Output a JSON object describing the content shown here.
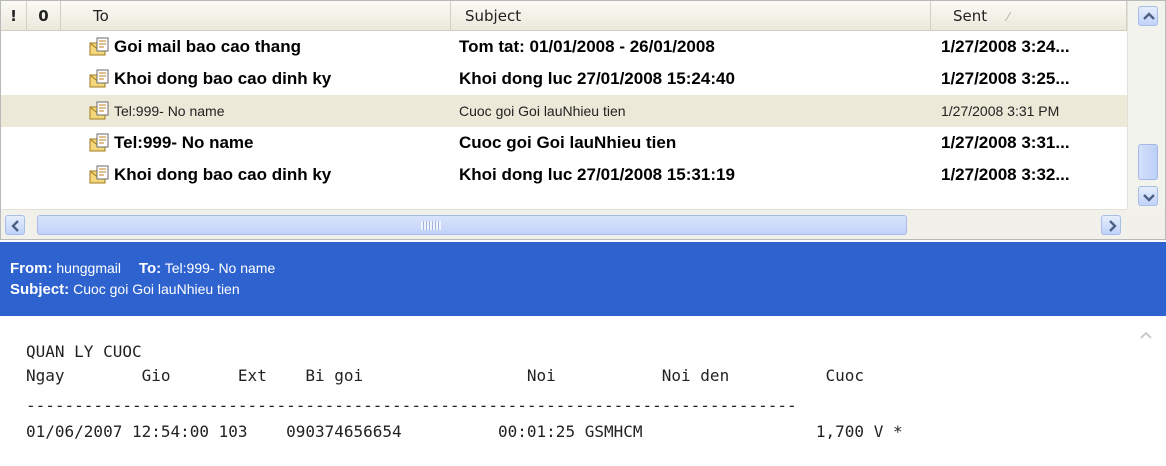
{
  "message_list": {
    "columns": {
      "importance": "!",
      "attachment": "0",
      "to": "To",
      "subject": "Subject",
      "sent": "Sent",
      "sent_sort_glyph": "⁄"
    },
    "rows": [
      {
        "to": "Goi mail bao cao thang",
        "subject": "Tom tat: 01/01/2008 - 26/01/2008",
        "sent": "1/27/2008 3:24...",
        "unread": true,
        "selected": false
      },
      {
        "to": "Khoi dong bao cao dinh ky",
        "subject": "Khoi dong luc 27/01/2008 15:24:40",
        "sent": "1/27/2008 3:25...",
        "unread": true,
        "selected": false
      },
      {
        "to": "Tel:999- No name",
        "subject": "Cuoc goi Goi lauNhieu tien",
        "sent": "1/27/2008 3:31 PM",
        "unread": false,
        "selected": true
      },
      {
        "to": "Tel:999- No name",
        "subject": "Cuoc goi Goi lauNhieu tien",
        "sent": "1/27/2008 3:31...",
        "unread": true,
        "selected": false
      },
      {
        "to": "Khoi dong bao cao dinh ky",
        "subject": "Khoi dong luc 27/01/2008 15:31:19",
        "sent": "1/27/2008 3:32...",
        "unread": true,
        "selected": false
      }
    ],
    "icon": "envelope-document-icon"
  },
  "preview": {
    "from_label": "From:",
    "from_value": "hunggmail",
    "to_label": "To:",
    "to_value": "Tel:999- No name",
    "subject_label": "Subject:",
    "subject_value": "Cuoc goi Goi lauNhieu tien",
    "body": {
      "title": "QUAN LY CUOC",
      "headers": "Ngay        Gio       Ext    Bi goi                 Noi           Noi den          Cuoc",
      "separator": "--------------------------------------------------------------------------------",
      "record": "01/06/2007 12:54:00 103    090374656654          00:01:25 GSMHCM                  1,700 V *"
    }
  },
  "colors": {
    "header_bar": "#2e63cf",
    "selected_row": "#ece9d8",
    "scrollbar": "#c1d3fb"
  }
}
